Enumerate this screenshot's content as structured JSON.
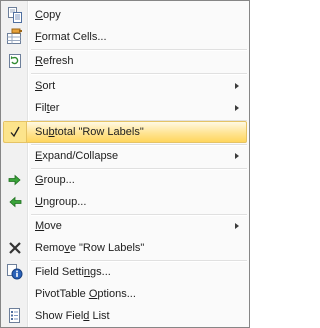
{
  "menu": {
    "items": [
      {
        "key": "copy",
        "pre": "",
        "u": "C",
        "post": "opy",
        "icon": "copy-icon",
        "submenu": false
      },
      {
        "key": "format-cells",
        "pre": "",
        "u": "F",
        "post": "ormat Cells...",
        "icon": "format-cells-icon",
        "submenu": false
      },
      {
        "key": "refresh",
        "pre": "",
        "u": "R",
        "post": "efresh",
        "icon": "refresh-icon",
        "submenu": false
      },
      {
        "key": "sort",
        "pre": "",
        "u": "S",
        "post": "ort",
        "icon": "",
        "submenu": true
      },
      {
        "key": "filter",
        "pre": "Fil",
        "u": "t",
        "post": "er",
        "icon": "",
        "submenu": true
      },
      {
        "key": "subtotal",
        "pre": "Su",
        "u": "b",
        "post": "total \"Row Labels\"",
        "icon": "checkmark-icon",
        "submenu": false,
        "checked": true,
        "highlighted": true
      },
      {
        "key": "expand-collapse",
        "pre": "",
        "u": "E",
        "post": "xpand/Collapse",
        "icon": "",
        "submenu": true
      },
      {
        "key": "group",
        "pre": "",
        "u": "G",
        "post": "roup...",
        "icon": "group-arrow-icon",
        "submenu": false
      },
      {
        "key": "ungroup",
        "pre": "",
        "u": "U",
        "post": "ngroup...",
        "icon": "ungroup-arrow-icon",
        "submenu": false
      },
      {
        "key": "move",
        "pre": "",
        "u": "M",
        "post": "ove",
        "icon": "",
        "submenu": true
      },
      {
        "key": "remove",
        "pre": "Remo",
        "u": "v",
        "post": "e \"Row Labels\"",
        "icon": "remove-x-icon",
        "submenu": false
      },
      {
        "key": "field-settings",
        "pre": "Field Setti",
        "u": "n",
        "post": "gs...",
        "icon": "field-settings-icon",
        "submenu": false
      },
      {
        "key": "pivottable-options",
        "pre": "PivotTable ",
        "u": "O",
        "post": "ptions...",
        "icon": "",
        "submenu": false
      },
      {
        "key": "show-field-list",
        "pre": "Show Fiel",
        "u": "d",
        "post": " List",
        "icon": "field-list-icon",
        "submenu": false
      }
    ]
  },
  "colors": {
    "highlight_top": "#fff9e3",
    "highlight_bottom": "#ffd65d",
    "highlight_border": "#e5c365",
    "green_arrow": "#3aa33a",
    "remove_x": "#333333"
  }
}
